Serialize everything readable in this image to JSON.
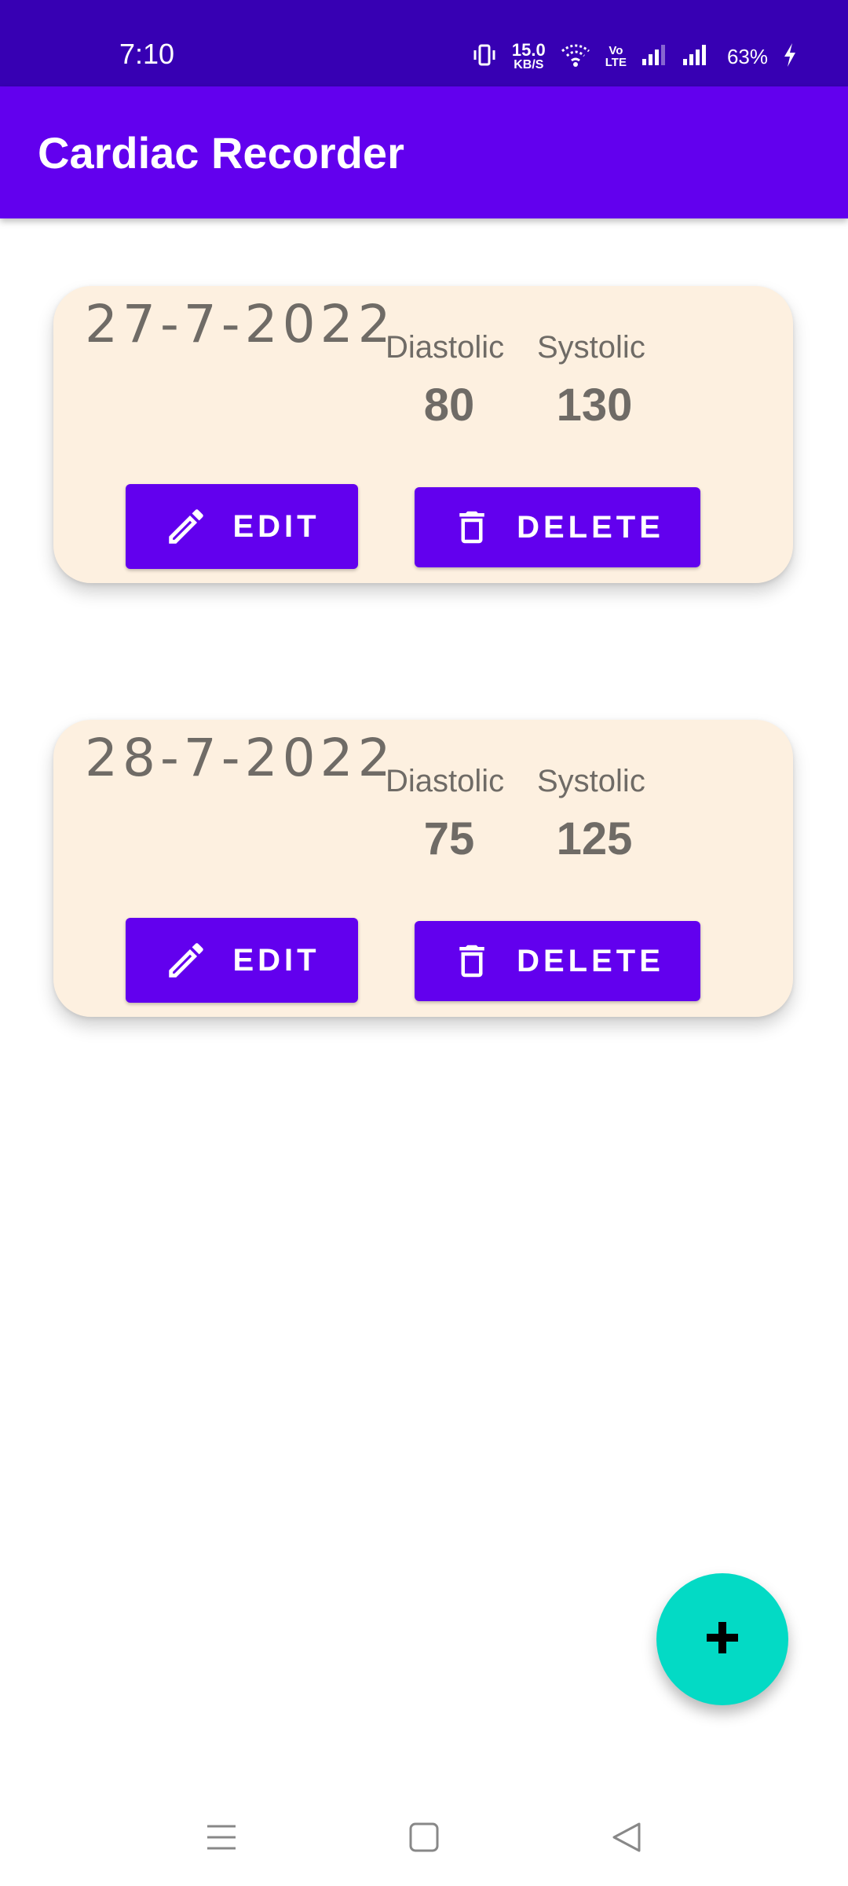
{
  "status_bar": {
    "time": "7:10",
    "speed_value": "15.0",
    "speed_unit": "KB/S",
    "volte_top": "Vo",
    "volte_bottom": "LTE",
    "battery": "63%"
  },
  "app_bar": {
    "title": "Cardiac Recorder"
  },
  "records": [
    {
      "date": "27-7-2022",
      "diastolic_label": "Diastolic",
      "systolic_label": "Systolic",
      "diastolic": "80",
      "systolic": "130",
      "edit_label": "EDIT",
      "delete_label": "DELETE"
    },
    {
      "date": "28-7-2022",
      "diastolic_label": "Diastolic",
      "systolic_label": "Systolic",
      "diastolic": "75",
      "systolic": "125",
      "edit_label": "EDIT",
      "delete_label": "DELETE"
    }
  ],
  "fab": {
    "icon": "plus-icon"
  },
  "colors": {
    "status_bar": "#3700b3",
    "primary": "#6200ee",
    "card_background": "#fdf0e0",
    "fab": "#03dac5",
    "text_muted": "#6f6b66"
  }
}
